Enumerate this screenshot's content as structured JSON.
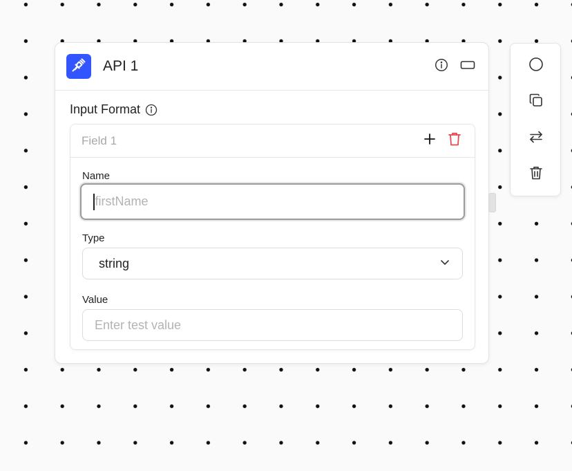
{
  "colors": {
    "accent": "#3355ff",
    "danger": "#e5484d",
    "page_background": "#fafafa",
    "dot": "#111111"
  },
  "block": {
    "icon": "plug-icon",
    "title": "API 1",
    "header_actions": [
      {
        "icon": "info-icon"
      },
      {
        "icon": "collapse-rectangle-icon"
      }
    ]
  },
  "input_format": {
    "label": "Input Format",
    "info_icon": "info-icon",
    "fields": [
      {
        "title": "Field 1",
        "add_icon": "plus-icon",
        "delete_icon": "trash-icon",
        "name_label": "Name",
        "name_placeholder": "firstName",
        "name_value": "",
        "type_label": "Type",
        "type_value": "string",
        "type_icon": "chevron-down-icon",
        "value_label": "Value",
        "value_placeholder": "Enter test value",
        "value_value": ""
      }
    ]
  },
  "toolbar": {
    "items": [
      {
        "icon": "circle-toggle-icon"
      },
      {
        "icon": "copy-icon"
      },
      {
        "icon": "swap-arrows-icon"
      },
      {
        "icon": "trash-icon"
      }
    ]
  }
}
